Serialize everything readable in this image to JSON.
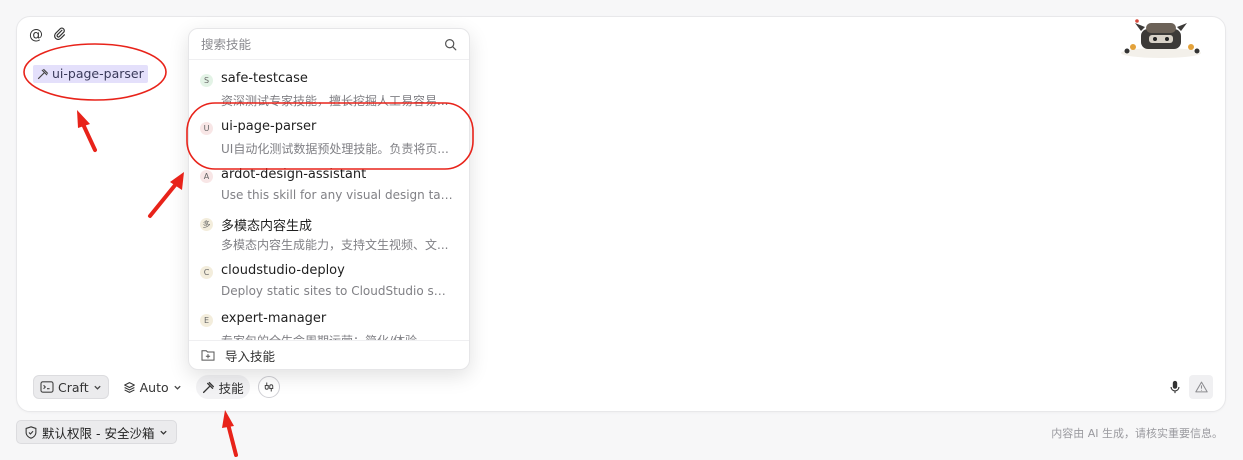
{
  "composer": {
    "at_icon": "@",
    "attach_icon": "paperclip-icon",
    "selected_skill": "ui-page-parser"
  },
  "skill_menu": {
    "search_placeholder": "搜索技能",
    "items": [
      {
        "badge": "S",
        "badge_color": "#e3f3e6",
        "title": "safe-testcase",
        "desc": "资深测试专家技能，擅长挖掘人工易容易..."
      },
      {
        "badge": "U",
        "badge_color": "#f8e6e6",
        "title": "ui-page-parser",
        "desc": "UI自动化测试数据预处理技能。负责将页..."
      },
      {
        "badge": "A",
        "badge_color": "#f8e6e6",
        "title": "ardot-design-assistant",
        "desc": "Use this skill for any visual design tas..."
      },
      {
        "badge": "多",
        "badge_color": "#f3eddc",
        "title": "多模态内容生成",
        "desc": "多模态内容生成能力，支持文生视频、文..."
      },
      {
        "badge": "C",
        "badge_color": "#f3eddc",
        "title": "cloudstudio-deploy",
        "desc": "Deploy static sites to CloudStudio san..."
      },
      {
        "badge": "E",
        "badge_color": "#f3eddc",
        "title": "expert-manager",
        "desc": "专家包的全生命周期运营：简化/体验..."
      }
    ],
    "import_label": "导入技能"
  },
  "toolbar": {
    "craft_label": "Craft",
    "auto_label": "Auto",
    "skills_label": "技能"
  },
  "footer": {
    "permission_label": "默认权限 - 安全沙箱",
    "disclaimer": "内容由 AI 生成，请核实重要信息。"
  },
  "colors": {
    "chip_bg": "#e4e0fb",
    "annotation_red": "#e8231a"
  }
}
